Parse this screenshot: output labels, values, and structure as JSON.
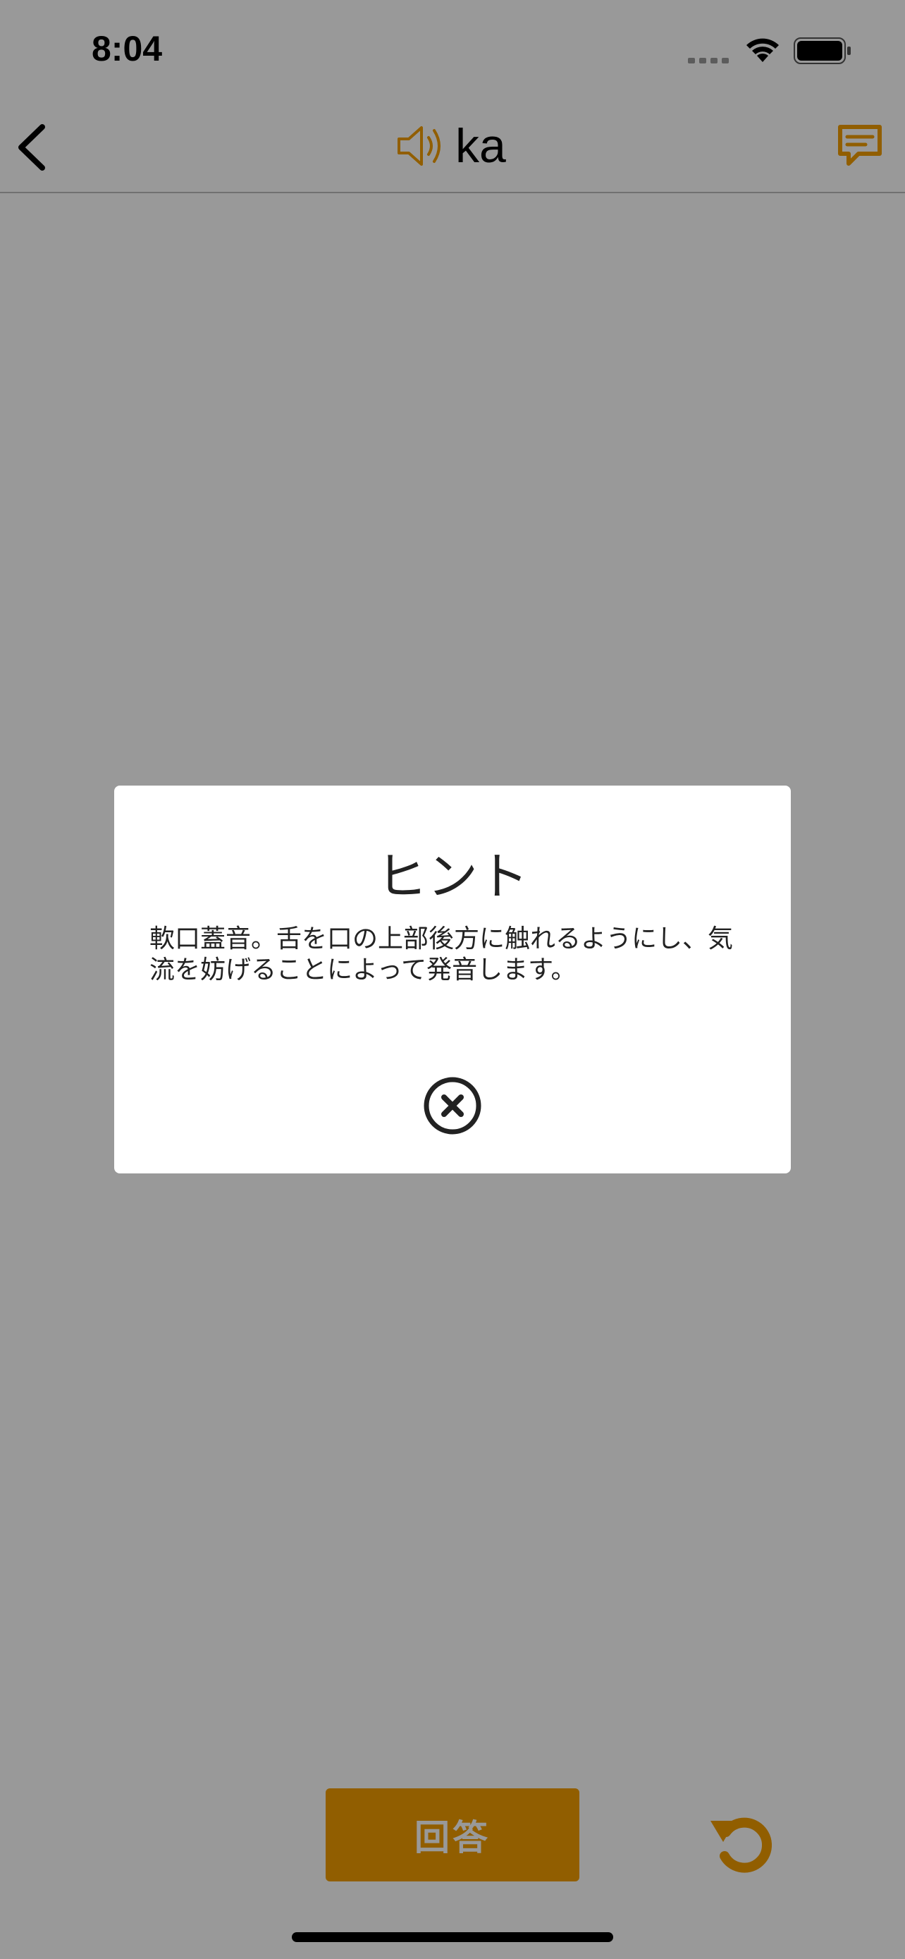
{
  "status_bar": {
    "time": "8:04"
  },
  "nav": {
    "title": "ka",
    "back_icon": "chevron-left-icon",
    "speaker_icon": "speaker-icon",
    "comment_icon": "comment-icon"
  },
  "modal": {
    "title": "ヒント",
    "body": "軟口蓋音。舌を口の上部後方に触れるようにし、気流を妨げることによって発音します。",
    "close_icon": "close-circle-icon"
  },
  "controls": {
    "answer_label": "回答",
    "reload_icon": "reload-icon"
  },
  "colors": {
    "accent": "#f29d00",
    "overlay": "rgba(0,0,0,0.40)",
    "text": "#222222"
  }
}
